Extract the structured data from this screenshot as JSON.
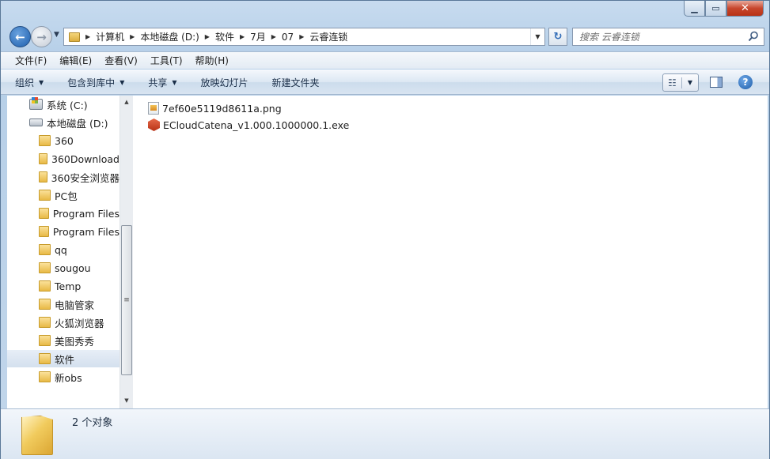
{
  "breadcrumb": [
    "计算机",
    "本地磁盘 (D:)",
    "软件",
    "7月",
    "07",
    "云睿连锁"
  ],
  "search": {
    "placeholder": "搜索 云睿连锁"
  },
  "menu": [
    "文件(F)",
    "编辑(E)",
    "查看(V)",
    "工具(T)",
    "帮助(H)"
  ],
  "commands": [
    {
      "label": "组织",
      "dropdown": true
    },
    {
      "label": "包含到库中",
      "dropdown": true
    },
    {
      "label": "共享",
      "dropdown": true
    },
    {
      "label": "放映幻灯片",
      "dropdown": false
    },
    {
      "label": "新建文件夹",
      "dropdown": false
    }
  ],
  "tree": [
    {
      "label": "系统 (C:)",
      "icon": "system-drive-icon",
      "indent": 1
    },
    {
      "label": "本地磁盘 (D:)",
      "icon": "drive-icon",
      "indent": 1
    },
    {
      "label": "360",
      "icon": "folder-icon",
      "indent": 2
    },
    {
      "label": "360Download",
      "icon": "folder-icon",
      "indent": 2
    },
    {
      "label": "360安全浏览器",
      "icon": "folder-icon",
      "indent": 2
    },
    {
      "label": "PC包",
      "icon": "folder-icon",
      "indent": 2
    },
    {
      "label": "Program Files",
      "icon": "folder-icon",
      "indent": 2
    },
    {
      "label": "Program Files",
      "icon": "folder-icon",
      "indent": 2
    },
    {
      "label": "qq",
      "icon": "folder-icon",
      "indent": 2
    },
    {
      "label": "sougou",
      "icon": "folder-icon",
      "indent": 2
    },
    {
      "label": "Temp",
      "icon": "folder-icon",
      "indent": 2
    },
    {
      "label": "电脑管家",
      "icon": "folder-icon",
      "indent": 2
    },
    {
      "label": "火狐浏览器",
      "icon": "folder-icon",
      "indent": 2
    },
    {
      "label": "美图秀秀",
      "icon": "folder-icon",
      "indent": 2
    },
    {
      "label": "软件",
      "icon": "folder-icon",
      "indent": 2,
      "selected": true
    },
    {
      "label": "新obs",
      "icon": "folder-icon",
      "indent": 2
    }
  ],
  "files": [
    {
      "name": "7ef60e5119d8611a.png",
      "icon": "png-file-icon"
    },
    {
      "name": "ECloudCatena_v1.000.1000000.1.exe",
      "icon": "exe-file-icon"
    }
  ],
  "details": {
    "status": "2 个对象"
  }
}
